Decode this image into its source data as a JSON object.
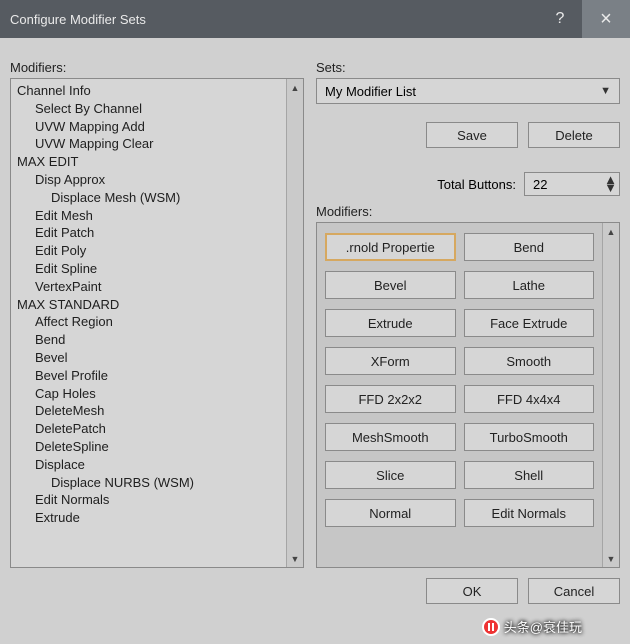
{
  "title": "Configure Modifier Sets",
  "left": {
    "label": "Modifiers:",
    "items": [
      {
        "text": "Channel Info",
        "indent": 0
      },
      {
        "text": "Select By Channel",
        "indent": 1
      },
      {
        "text": "UVW Mapping Add",
        "indent": 1
      },
      {
        "text": "UVW Mapping Clear",
        "indent": 1
      },
      {
        "text": "MAX EDIT",
        "indent": 0
      },
      {
        "text": "Disp Approx",
        "indent": 1
      },
      {
        "text": "Displace Mesh (WSM)",
        "indent": 2
      },
      {
        "text": "Edit Mesh",
        "indent": 1
      },
      {
        "text": "Edit Patch",
        "indent": 1
      },
      {
        "text": "Edit Poly",
        "indent": 1
      },
      {
        "text": "Edit Spline",
        "indent": 1
      },
      {
        "text": "VertexPaint",
        "indent": 1
      },
      {
        "text": "MAX STANDARD",
        "indent": 0
      },
      {
        "text": "Affect Region",
        "indent": 1
      },
      {
        "text": "Bend",
        "indent": 1
      },
      {
        "text": "Bevel",
        "indent": 1
      },
      {
        "text": "Bevel Profile",
        "indent": 1
      },
      {
        "text": "Cap Holes",
        "indent": 1
      },
      {
        "text": "DeleteMesh",
        "indent": 1
      },
      {
        "text": "DeletePatch",
        "indent": 1
      },
      {
        "text": "DeleteSpline",
        "indent": 1
      },
      {
        "text": "Displace",
        "indent": 1
      },
      {
        "text": "Displace NURBS (WSM)",
        "indent": 2
      },
      {
        "text": "Edit Normals",
        "indent": 1
      },
      {
        "text": "Extrude",
        "indent": 1
      }
    ]
  },
  "right": {
    "sets_label": "Sets:",
    "combo_value": "My Modifier List",
    "save": "Save",
    "delete": "Delete",
    "total_buttons_label": "Total Buttons:",
    "total_buttons_value": "22",
    "modifiers_label": "Modifiers:",
    "buttons": [
      {
        "label": "Arnold Properties",
        "display": ".rnold Propertie",
        "selected": true
      },
      {
        "label": "Bend"
      },
      {
        "label": "Bevel"
      },
      {
        "label": "Lathe"
      },
      {
        "label": "Extrude"
      },
      {
        "label": "Face Extrude"
      },
      {
        "label": "XForm"
      },
      {
        "label": "Smooth"
      },
      {
        "label": "FFD 2x2x2"
      },
      {
        "label": "FFD 4x4x4"
      },
      {
        "label": "MeshSmooth"
      },
      {
        "label": "TurboSmooth"
      },
      {
        "label": "Slice"
      },
      {
        "label": "Shell"
      },
      {
        "label": "Normal"
      },
      {
        "label": "Edit Normals"
      }
    ]
  },
  "footer": {
    "ok": "OK",
    "cancel": "Cancel"
  },
  "watermark": "头条@衰佳玩"
}
